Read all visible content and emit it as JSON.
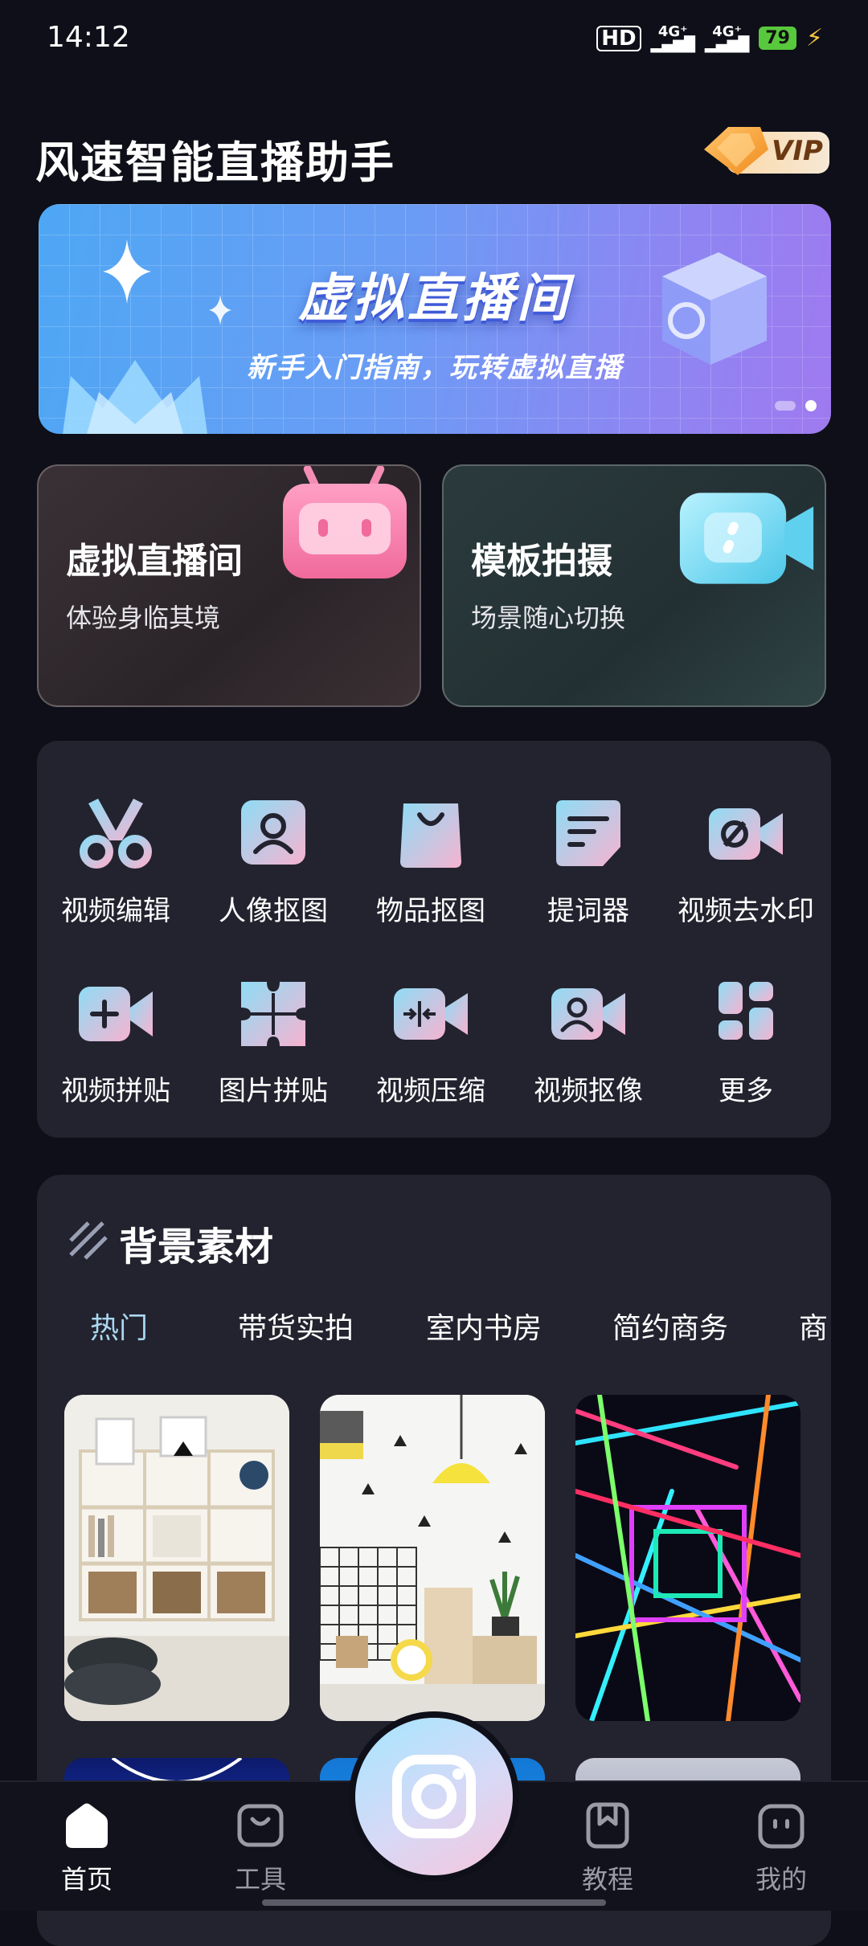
{
  "status_bar": {
    "time": "14:12",
    "hd": "HD",
    "net1": "4G⁺",
    "net2": "4G⁺",
    "battery": "79"
  },
  "header": {
    "title": "风速智能直播助手",
    "vip_label": "VIP"
  },
  "banner": {
    "title": "虚拟直播间",
    "subtitle": "新手入门指南，玩转虚拟直播"
  },
  "feature_cards": [
    {
      "title": "虚拟直播间",
      "subtitle": "体验身临其境"
    },
    {
      "title": "模板拍摄",
      "subtitle": "场景随心切换"
    }
  ],
  "tools": [
    {
      "label": "视频编辑",
      "icon": "scissors-icon"
    },
    {
      "label": "人像抠图",
      "icon": "portrait-icon"
    },
    {
      "label": "物品抠图",
      "icon": "bag-icon"
    },
    {
      "label": "提词器",
      "icon": "teleprompter-icon"
    },
    {
      "label": "视频去水印",
      "icon": "video-watermark-icon"
    },
    {
      "label": "视频拼贴",
      "icon": "video-add-icon"
    },
    {
      "label": "图片拼贴",
      "icon": "puzzle-icon"
    },
    {
      "label": "视频压缩",
      "icon": "compress-icon"
    },
    {
      "label": "视频抠像",
      "icon": "video-portrait-icon"
    },
    {
      "label": "更多",
      "icon": "more-grid-icon"
    }
  ],
  "materials": {
    "title": "背景素材",
    "tabs": [
      "热门",
      "带货实拍",
      "室内书房",
      "简约商务",
      "商"
    ],
    "active_tab": "热门"
  },
  "nav": [
    {
      "label": "首页",
      "icon": "home-icon"
    },
    {
      "label": "工具",
      "icon": "toolbox-icon"
    },
    {
      "label": "教程",
      "icon": "bookmark-icon"
    },
    {
      "label": "我的",
      "icon": "profile-face-icon"
    }
  ],
  "colors": {
    "background": "#0e0f18",
    "panel": "#23232f",
    "accent_cyan": "#8fdcf5",
    "accent_pink": "#f6a9c9",
    "active_tab": "#a9d8f0"
  }
}
